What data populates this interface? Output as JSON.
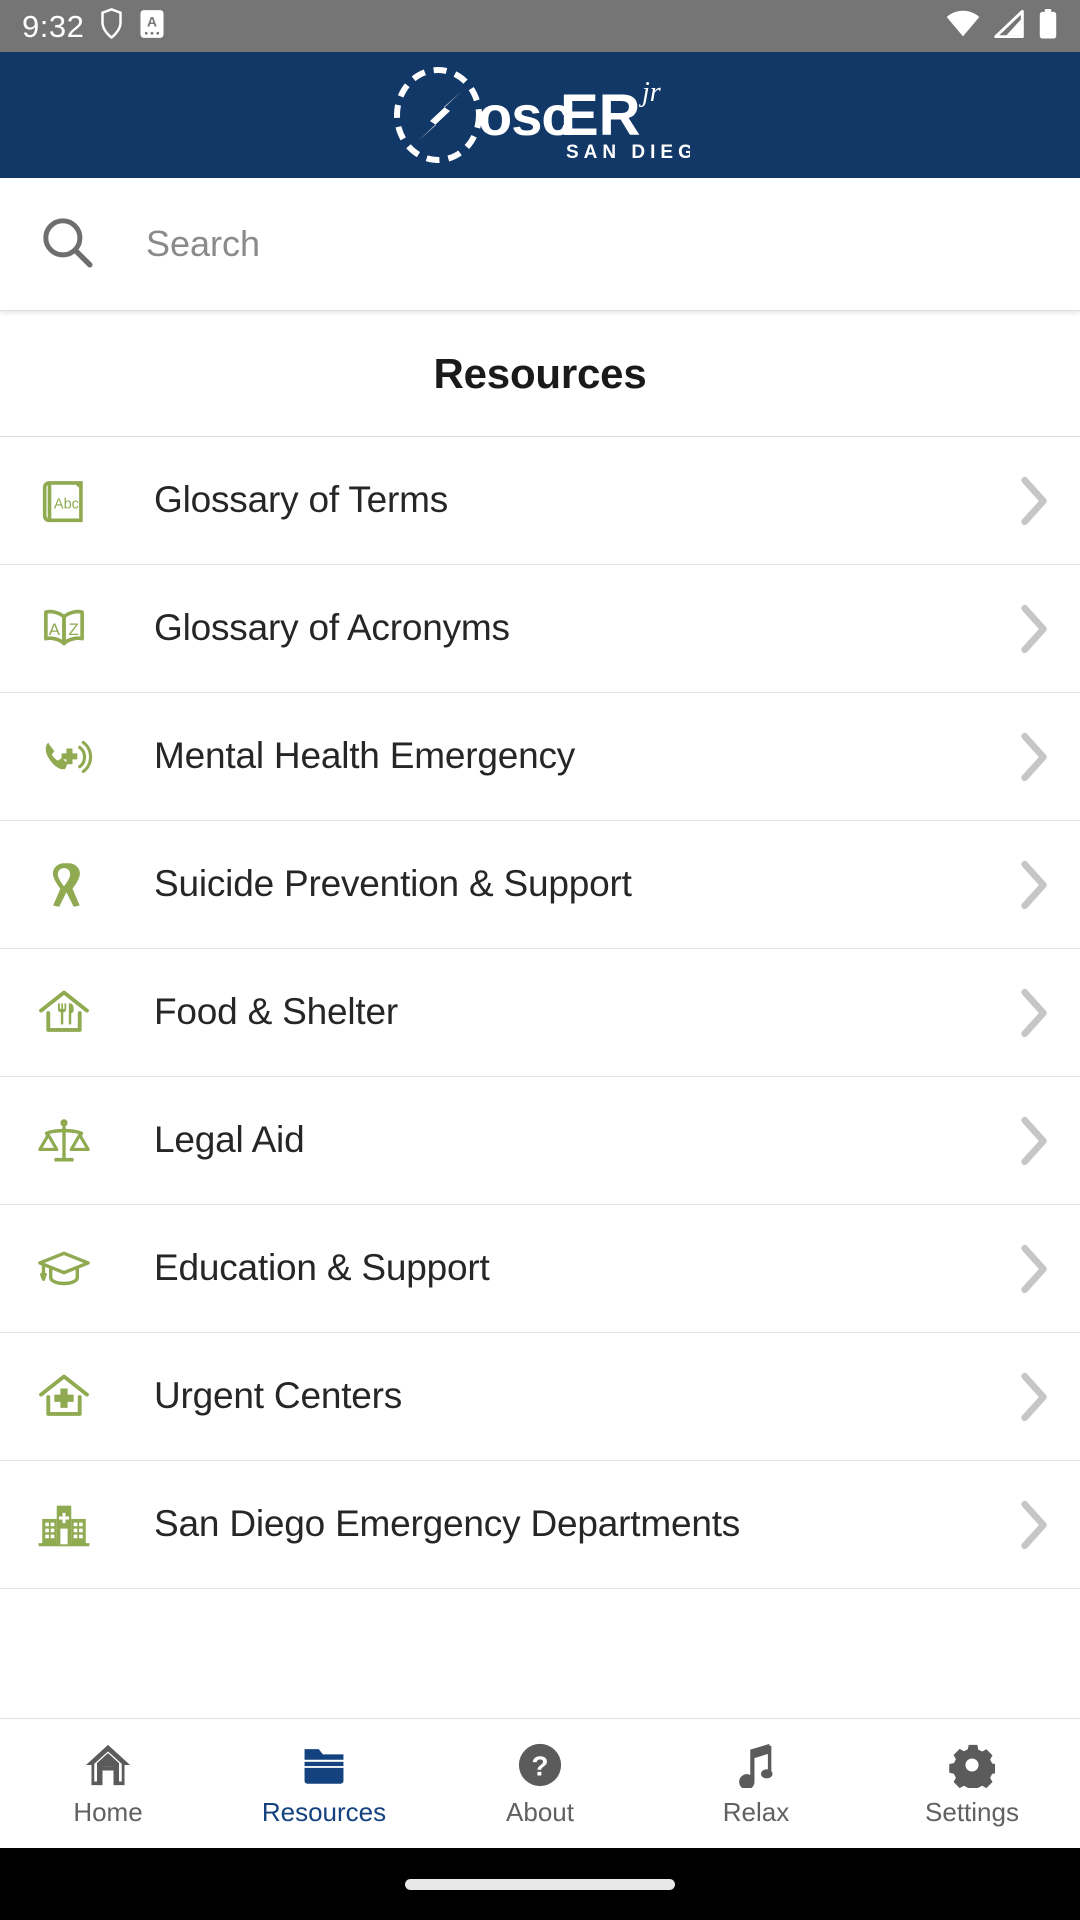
{
  "status_bar": {
    "time": "9:32",
    "left_icons": [
      "shield-icon",
      "app-notification-icon"
    ],
    "right_icons": [
      "wifi-icon",
      "cellular-signal-icon",
      "battery-icon"
    ],
    "background_color": "#757575"
  },
  "app_bar": {
    "logo_name": "oscER",
    "logo_superscript": "jr",
    "logo_subtitle": "SAN DIEGO",
    "logo_icon": "compass-icon",
    "background_color": "#123868"
  },
  "search": {
    "placeholder": "Search",
    "value": "",
    "icon": "search-icon"
  },
  "page": {
    "title": "Resources"
  },
  "resources": {
    "accent_color": "#8faa51",
    "items": [
      {
        "label": "Glossary of Terms",
        "icon": "book-abc-icon",
        "chevron": "chevron-right-icon"
      },
      {
        "label": "Glossary of Acronyms",
        "icon": "open-book-az-icon",
        "chevron": "chevron-right-icon"
      },
      {
        "label": "Mental Health Emergency",
        "icon": "emergency-call-icon",
        "chevron": "chevron-right-icon"
      },
      {
        "label": "Suicide Prevention & Support",
        "icon": "awareness-ribbon-icon",
        "chevron": "chevron-right-icon"
      },
      {
        "label": "Food & Shelter",
        "icon": "house-meal-icon",
        "chevron": "chevron-right-icon"
      },
      {
        "label": "Legal Aid",
        "icon": "scales-of-justice-icon",
        "chevron": "chevron-right-icon"
      },
      {
        "label": "Education & Support",
        "icon": "graduation-cap-icon",
        "chevron": "chevron-right-icon"
      },
      {
        "label": "Urgent Centers",
        "icon": "house-medical-icon",
        "chevron": "chevron-right-icon"
      },
      {
        "label": "San Diego Emergency Departments",
        "icon": "hospital-building-icon",
        "chevron": "chevron-right-icon"
      }
    ]
  },
  "bottom_nav": {
    "active_index": 1,
    "active_color": "#14427e",
    "inactive_color": "#616161",
    "items": [
      {
        "label": "Home",
        "icon": "home-icon"
      },
      {
        "label": "Resources",
        "icon": "folder-icon"
      },
      {
        "label": "About",
        "icon": "question-circle-icon"
      },
      {
        "label": "Relax",
        "icon": "music-note-icon"
      },
      {
        "label": "Settings",
        "icon": "gear-icon"
      }
    ]
  }
}
